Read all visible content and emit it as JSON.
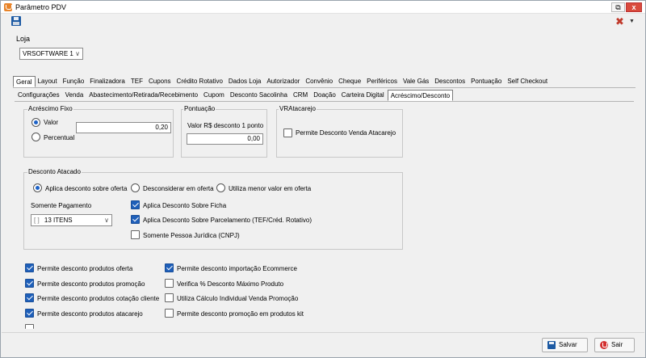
{
  "window": {
    "title": "Parâmetro PDV",
    "restore": "⧉",
    "close": "x"
  },
  "loja": {
    "label": "Loja",
    "selected": "VRSOFTWARE 1"
  },
  "main_tabs": [
    "Geral",
    "Layout",
    "Função",
    "Finalizadora",
    "TEF",
    "Cupons",
    "Crédito Rotativo",
    "Dados Loja",
    "Autorizador",
    "Convênio",
    "Cheque",
    "Periféricos",
    "Vale Gás",
    "Descontos",
    "Pontuação",
    "Self Checkout"
  ],
  "sub_tabs": [
    "Configurações",
    "Venda",
    "Abastecimento/Retirada/Recebimento",
    "Cupom",
    "Desconto Sacolinha",
    "CRM",
    "Doação",
    "Carteira Digital",
    "Acréscimo/Desconto"
  ],
  "acrescimo_fixo": {
    "title": "Acréscimo Fixo",
    "valor_label": "Valor",
    "percentual_label": "Percentual",
    "value": "0,20"
  },
  "pontuacao": {
    "title": "Pontuação",
    "label": "Valor R$ desconto 1 ponto",
    "value": "0,00"
  },
  "vraatacarejo": {
    "title": "VRAtacarejo",
    "check_label": "Permite Desconto Venda Atacarejo"
  },
  "desconto_atacado": {
    "title": "Desconto Atacado",
    "radios": [
      "Aplica desconto sobre oferta",
      "Desconsiderar em oferta",
      "Utiliza menor valor em oferta"
    ],
    "somente_pagamento_label": "Somente Pagamento",
    "payment_selected": "13 ITENS",
    "payment_brackets": "[  ]",
    "checks": [
      "Aplica Desconto Sobre Ficha",
      "Aplica Desconto Sobre Parcelamento (TEF/Créd. Rotativo)",
      "Somente Pessoa Jurídica (CNPJ)"
    ]
  },
  "options_left": [
    "Permite desconto produtos oferta",
    "Permite desconto produtos promoção",
    "Permite desconto produtos cotação cliente",
    "Permite desconto produtos atacarejo"
  ],
  "options_right": [
    "Permite desconto importação Ecommerce",
    "Verifica % Desconto Máximo Produto",
    "Utiliza Cálculo Individual Venda Promoção",
    "Permite desconto promoção em produtos kit"
  ],
  "buttons": {
    "save": "Salvar",
    "exit": "Sair"
  }
}
